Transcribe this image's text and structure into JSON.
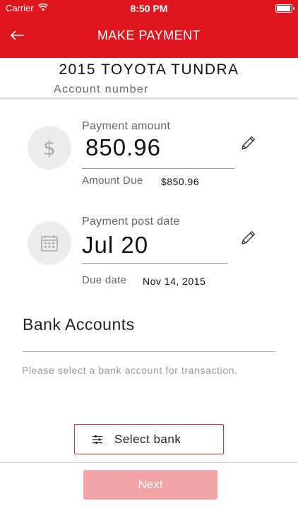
{
  "status_bar": {
    "carrier": "Carrier",
    "time": "8:50 PM",
    "battery_level": 1.0
  },
  "header": {
    "title": "MAKE PAYMENT"
  },
  "vehicle": {
    "name": "2015 TOYOTA TUNDRA",
    "account_label": "Account number"
  },
  "payment_amount": {
    "label": "Payment amount",
    "value": "850.96",
    "due_label": "Amount Due",
    "due_value": "$850.96"
  },
  "post_date": {
    "label": "Payment post date",
    "value": "Jul 20",
    "due_label": "Due date",
    "due_value": "Nov 14, 2015"
  },
  "bank_accounts": {
    "title": "Bank Accounts",
    "helper": "Please select a bank account for transaction."
  },
  "buttons": {
    "select_bank": "Select bank",
    "next": "Next"
  },
  "colors": {
    "brand_red": "#e0161f",
    "next_disabled": "#f2a3a6"
  }
}
